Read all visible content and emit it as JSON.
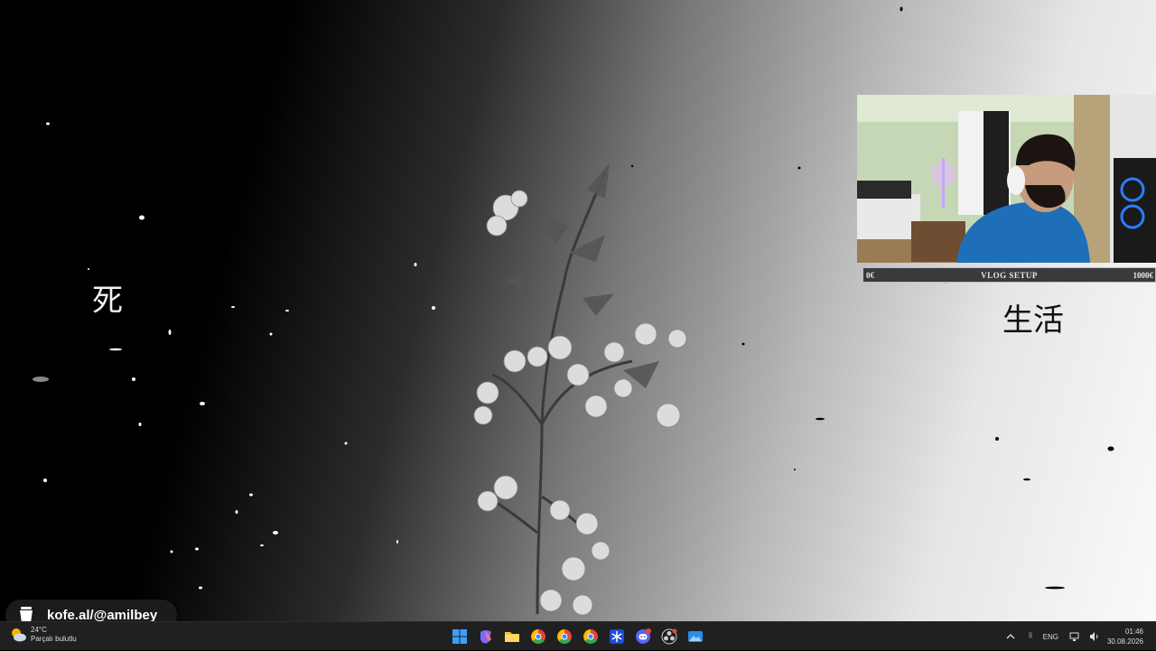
{
  "desktop": {
    "kanji_left": "死",
    "kanji_right": "生活"
  },
  "overlay": {
    "progress": {
      "start_label": "0€",
      "title": "VLOG SETUP",
      "end_label": "1000€",
      "value_fraction": 0.0
    },
    "kofe_badge": {
      "text": "kofe.al/@amilbey",
      "icon": "coffee-cup-icon"
    }
  },
  "taskbar": {
    "weather": {
      "temperature": "24°C",
      "condition": "Parçalı bulutlu",
      "icon": "partly-cloudy-icon"
    },
    "apps": [
      {
        "name": "start-button",
        "icon": "windows-logo-icon"
      },
      {
        "name": "copilot-app",
        "icon": "copilot-icon"
      },
      {
        "name": "file-explorer-app",
        "icon": "folder-icon"
      },
      {
        "name": "chrome-app-1",
        "icon": "chrome-icon"
      },
      {
        "name": "chrome-app-2",
        "icon": "chrome-icon"
      },
      {
        "name": "chrome-app-3",
        "icon": "chrome-icon"
      },
      {
        "name": "snowflake-app",
        "icon": "snowflake-icon"
      },
      {
        "name": "discord-app",
        "icon": "discord-icon",
        "badge": "9+"
      },
      {
        "name": "obs-app",
        "icon": "obs-icon"
      },
      {
        "name": "photos-app",
        "icon": "photos-icon"
      }
    ],
    "tray": {
      "language": "ENG",
      "time": "01:46",
      "date": "30.08.2026"
    }
  },
  "colors": {
    "taskbar_bg": "#202020",
    "windows_blue": "#3aa0ff",
    "discord": "#5865f2",
    "chrome_red": "#e94235",
    "chrome_yellow": "#fbbc05",
    "chrome_green": "#34a853"
  }
}
